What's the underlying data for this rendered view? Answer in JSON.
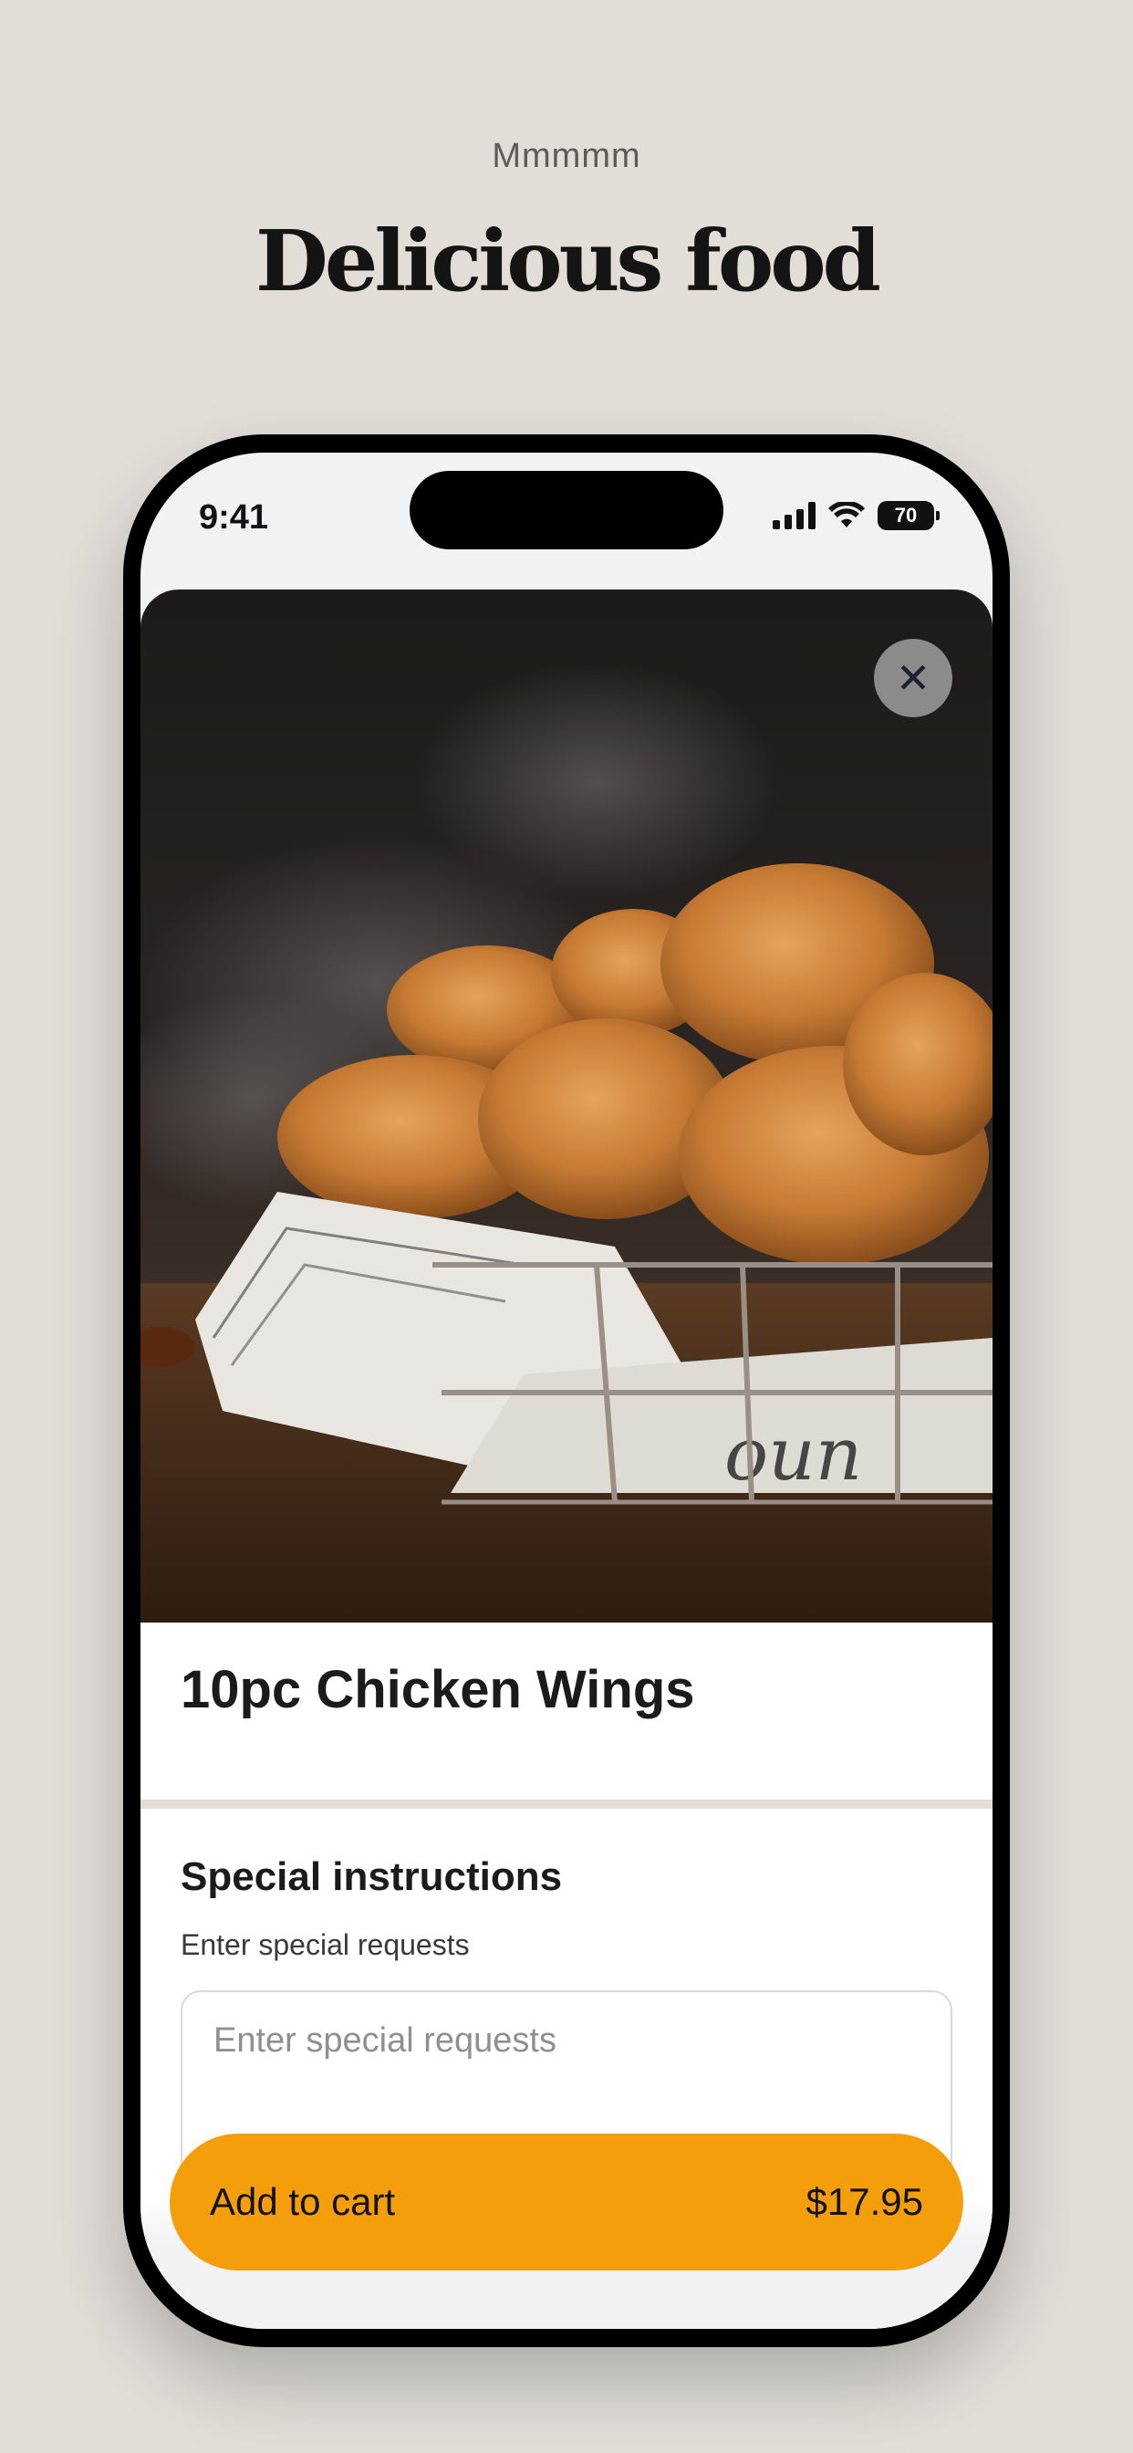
{
  "marketing": {
    "eyebrow": "Mmmmm",
    "headline": "Delicious food"
  },
  "status_bar": {
    "time": "9:41",
    "battery": "70"
  },
  "item": {
    "title": "10pc Chicken Wings",
    "image_description": "Fried chicken pieces in a wire basket lined with newspaper"
  },
  "close_button": {
    "icon": "close-icon",
    "glyph": "✕"
  },
  "special_instructions": {
    "title": "Special instructions",
    "subtitle": "Enter special requests",
    "placeholder": "Enter special requests"
  },
  "cart": {
    "label": "Add to cart",
    "price": "$17.95"
  },
  "colors": {
    "accent": "#f59e0b",
    "background": "#e2ddd7"
  }
}
